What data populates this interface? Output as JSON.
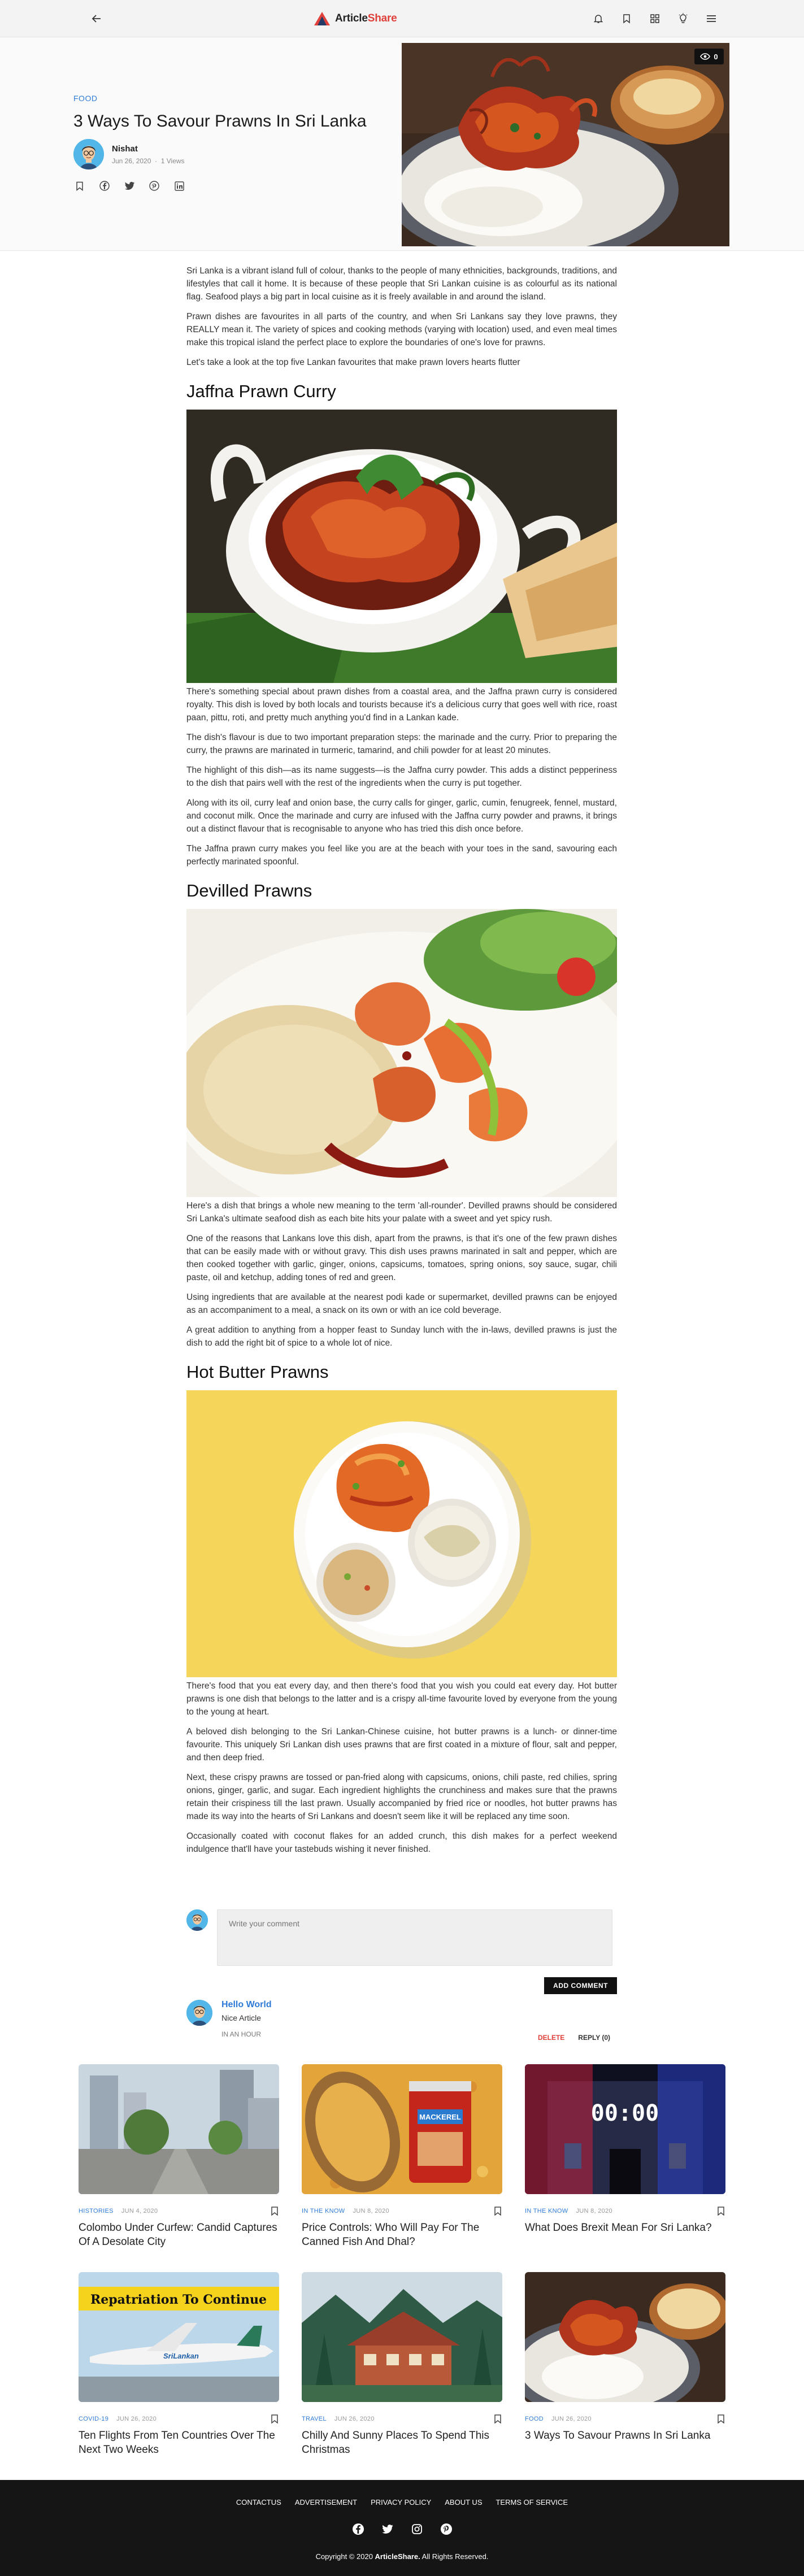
{
  "header": {
    "brand_part1": "Article",
    "brand_part2": "Share"
  },
  "hero": {
    "category": "FOOD",
    "title": "3 Ways To Savour Prawns In Sri Lanka",
    "author_name": "Nishat",
    "date": "Jun 26, 2020",
    "views": "1 Views",
    "view_count": "0"
  },
  "article": {
    "intro": [
      "Sri Lanka is a vibrant island full of colour, thanks to the people of many ethnicities, backgrounds, traditions, and lifestyles that call it home. It is because of these people that Sri Lankan cuisine is as colourful as its national flag. Seafood plays a big part in local cuisine as it is freely available in and around the island.",
      "Prawn dishes are favourites in all parts of the country, and when Sri Lankans say they love prawns, they REALLY mean it. The variety of spices and cooking methods (varying with location) used, and even meal times make this tropical island the perfect place to explore the boundaries of one's love for prawns.",
      "Let's take a look at the top five Lankan favourites that make prawn lovers hearts flutter"
    ],
    "sections": [
      {
        "heading": "Jaffna Prawn Curry",
        "paragraphs": [
          "There's something special about prawn dishes from a coastal area, and the Jaffna prawn curry is considered royalty. This dish is loved by both locals and tourists because it's a delicious curry that goes well with rice, roast paan, pittu, roti, and pretty much anything you'd find in a Lankan kade.",
          "The dish's flavour is due to two important preparation steps: the marinade and the curry. Prior to preparing the curry, the prawns are marinated in turmeric, tamarind, and chili powder for at least 20 minutes.",
          "The highlight of this dish—as its name suggests—is the Jaffna curry powder. This adds a distinct pepperiness to the dish that pairs well with the rest of the ingredients when the curry is put together.",
          "Along with its oil, curry leaf and onion base, the curry calls for ginger, garlic, cumin, fenugreek, fennel, mustard, and coconut milk. Once the marinade and curry are infused with the Jaffna curry powder and prawns, it brings out a distinct flavour that is recognisable to anyone who has tried this dish once before.",
          "The Jaffna prawn curry makes you feel like you are at the beach with your toes in the sand, savouring each perfectly marinated spoonful."
        ]
      },
      {
        "heading": "Devilled Prawns",
        "paragraphs": [
          "Here's a dish that brings a whole new meaning to the term 'all-rounder'. Devilled prawns should be considered Sri Lanka's ultimate seafood dish as each bite hits your palate with a sweet and yet spicy rush.",
          "One of the reasons that Lankans love this dish, apart from the prawns, is that it's one of the few prawn dishes that can be easily made with or without gravy. This dish uses prawns marinated in salt and pepper, which are then cooked together with garlic, ginger, onions, capsicums, tomatoes, spring onions, soy sauce, sugar, chili paste, oil and ketchup, adding tones of red and green.",
          "Using ingredients that are available at the nearest podi kade or supermarket, devilled prawns can be enjoyed as an accompaniment to a meal, a snack on its own or with an ice cold beverage.",
          "A great addition to anything from a hopper feast to Sunday lunch with the in-laws, devilled prawns is just the dish to add the right bit of spice to a whole lot of nice."
        ]
      },
      {
        "heading": "Hot Butter Prawns",
        "paragraphs": [
          "There's food that you eat every day, and then there's food that you wish you could eat every day. Hot butter prawns is one dish that belongs to the latter and is a crispy all-time favourite loved by everyone from the young to the young at heart.",
          "A beloved dish belonging to the Sri Lankan-Chinese cuisine, hot butter prawns is a lunch- or dinner-time favourite. This uniquely Sri Lankan dish uses prawns that are first coated in a mixture of flour, salt and pepper, and then deep fried.",
          "Next, these crispy prawns are tossed or pan-fried along with capsicums, onions, chili paste, red chilies, spring onions, ginger, garlic, and sugar. Each ingredient highlights the crunchiness and makes sure that the prawns retain their crispiness till the last prawn. Usually accompanied by fried rice or noodles, hot butter prawns has made its way into the hearts of Sri Lankans and doesn't seem like it will be replaced any time soon.",
          "Occasionally coated with coconut flakes for an added crunch, this dish makes for a perfect weekend indulgence that'll have your tastebuds wishing it never finished."
        ]
      }
    ]
  },
  "comments": {
    "placeholder": "Write your comment",
    "add_label": "ADD COMMENT",
    "items": [
      {
        "name": "Hello World",
        "text": "Nice Article",
        "date": "IN AN HOUR",
        "delete_label": "DELETE",
        "reply_label": "REPLY (0)"
      }
    ]
  },
  "related": [
    {
      "category": "HISTORIES",
      "date": "JUN 4, 2020",
      "title": "Colombo Under Curfew: Candid Captures Of A Desolate City"
    },
    {
      "category": "IN THE KNOW",
      "date": "JUN 8, 2020",
      "title": "Price Controls: Who Will Pay For The Canned Fish And Dhal?"
    },
    {
      "category": "IN THE KNOW",
      "date": "JUN 8, 2020",
      "title": "What Does Brexit Mean For Sri Lanka?"
    },
    {
      "category": "COVID-19",
      "date": "JUN 26, 2020",
      "title": "Ten Flights From Ten Countries Over The Next Two Weeks"
    },
    {
      "category": "TRAVEL",
      "date": "JUN 26, 2020",
      "title": "Chilly And Sunny Places To Spend This Christmas"
    },
    {
      "category": "FOOD",
      "date": "JUN 26, 2020",
      "title": "3 Ways To Savour Prawns In Sri Lanka"
    }
  ],
  "related_images": {
    "can_brand": "MACKEREL",
    "clock_text": "00:00",
    "banner_text": "Repatriation To Continue",
    "plane_text": "SriLankan"
  },
  "footer": {
    "links": [
      "CONTACTUS",
      "ADVERTISEMENT",
      "PRIVACY POLICY",
      "ABOUT US",
      "TERMS OF SERVICE"
    ],
    "copyright_prefix": "Copyright © 2020 ",
    "copyright_brand": "ArticleShare.",
    "copyright_suffix": " All Rights Reserved."
  },
  "icons": {
    "topbar": [
      "back-arrow-icon",
      "bell-icon",
      "bookmark-icon",
      "grid-icon",
      "lightbulb-icon",
      "menu-icon"
    ],
    "share": [
      "bookmark-icon",
      "facebook-icon",
      "twitter-icon",
      "pinterest-icon",
      "linkedin-icon"
    ],
    "footer": [
      "facebook-icon",
      "twitter-icon",
      "instagram-icon",
      "pinterest-icon"
    ]
  },
  "colors": {
    "accent": "#2f7bd8",
    "brand_red": "#e0413a",
    "footer_bg": "#151515"
  }
}
